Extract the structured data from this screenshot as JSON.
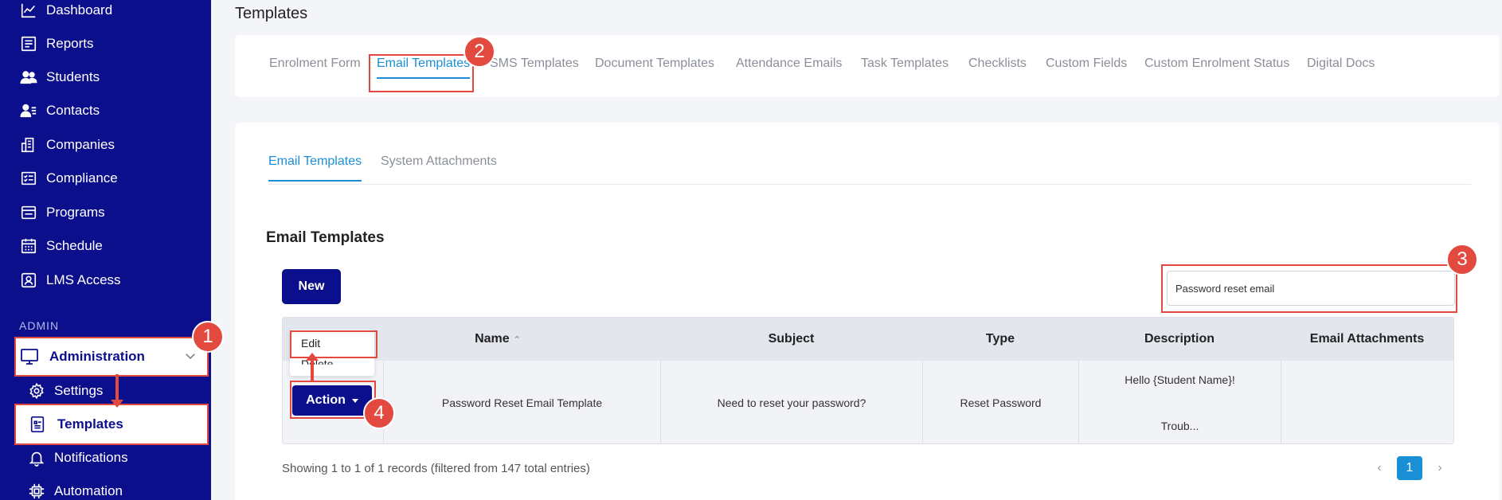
{
  "sidebar": {
    "items": [
      {
        "label": "Dashboard",
        "icon": "chart-line-icon"
      },
      {
        "label": "Reports",
        "icon": "report-icon"
      },
      {
        "label": "Students",
        "icon": "users-icon"
      },
      {
        "label": "Contacts",
        "icon": "contacts-icon"
      },
      {
        "label": "Companies",
        "icon": "building-icon"
      },
      {
        "label": "Compliance",
        "icon": "checklist-icon"
      },
      {
        "label": "Programs",
        "icon": "window-icon"
      },
      {
        "label": "Schedule",
        "icon": "calendar-icon"
      },
      {
        "label": "LMS Access",
        "icon": "user-badge-icon"
      }
    ],
    "section_label": "ADMIN",
    "administration": "Administration",
    "sub_items": [
      {
        "label": "Settings",
        "icon": "gear-icon"
      },
      {
        "label": "Templates",
        "icon": "template-icon"
      },
      {
        "label": "Notifications",
        "icon": "bell-icon"
      },
      {
        "label": "Automation",
        "icon": "chip-icon"
      }
    ]
  },
  "page": {
    "title": "Templates"
  },
  "top_tabs": [
    "Enrolment Form",
    "Email Templates",
    "SMS Templates",
    "Document Templates",
    "Attendance Emails",
    "Task Templates",
    "Checklists",
    "Custom Fields",
    "Custom Enrolment Status",
    "Digital Docs"
  ],
  "sub_tabs": [
    "Email Templates",
    "System Attachments"
  ],
  "section": {
    "title": "Email Templates",
    "new_label": "New",
    "search_value": "Password reset email"
  },
  "table": {
    "headers": [
      "Name",
      "Subject",
      "Type",
      "Description",
      "Email Attachments"
    ],
    "row": {
      "name": "Password Reset Email Template",
      "subject": "Need to reset your password?",
      "type": "Reset Password",
      "description_line1": "Hello {Student Name}!",
      "description_line2": "Troub..."
    }
  },
  "dropdown": {
    "edit": "Edit",
    "delete": "Delete"
  },
  "action_label": "Action",
  "footer": {
    "info": "Showing 1 to 1 of 1 records (filtered from 147 total entries)",
    "page": "1",
    "prev": "‹",
    "next": "›"
  },
  "annotations": [
    "1",
    "2",
    "3",
    "4"
  ],
  "colors": {
    "sidebar_bg": "#0b0f8c",
    "accent": "#1b8fd6",
    "annotation": "#e24a3f"
  }
}
